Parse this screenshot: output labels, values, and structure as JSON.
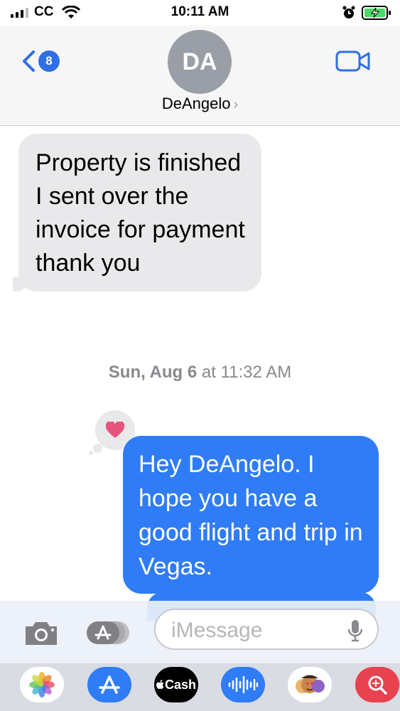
{
  "status_bar": {
    "carrier": "CC",
    "time": "10:11 AM"
  },
  "header": {
    "back_count": "8",
    "avatar_initials": "DA",
    "contact_name": "DeAngelo",
    "chevron": "›"
  },
  "messages": [
    {
      "direction": "incoming",
      "text": "Property is finished I sent over the invoice for payment thank you"
    },
    {
      "direction": "outgoing",
      "text": "Hey DeAngelo. I hope you have a good flight and trip in Vegas.",
      "tapback": "heart"
    }
  ],
  "timestamp": {
    "day": "Sun, Aug 6",
    "at": "at",
    "time": "11:32 AM"
  },
  "composer": {
    "placeholder": "iMessage"
  },
  "app_drawer": {
    "cash_label": "Cash"
  },
  "colors": {
    "blue": "#2f7cf6",
    "incoming_bubble": "#e9e9eb",
    "heart": "#e8537e"
  }
}
